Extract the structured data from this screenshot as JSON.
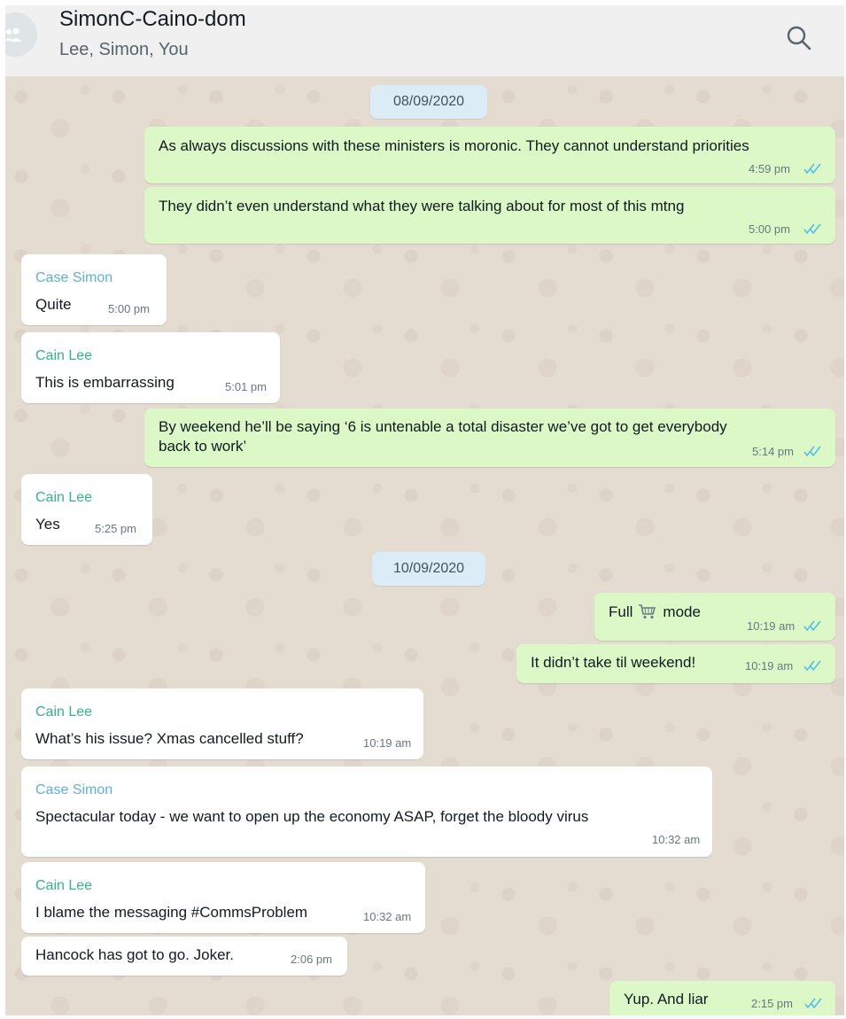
{
  "header": {
    "title": "SimonC-Caino-dom",
    "members": "Lee, Simon, You",
    "icons": [
      "group-avatar-icon",
      "search-icon"
    ]
  },
  "colors": {
    "outgoing_bubble": "#dcf8c6",
    "incoming_bubble": "#ffffff",
    "date_chip": "#dbecf6",
    "read_ticks": "#53bdeb",
    "sender_cain": "#35b289",
    "sender_case": "#5fb0d6"
  },
  "dates": {
    "d1": "08/09/2020",
    "d2": "10/09/2020"
  },
  "messages": [
    {
      "direction": "out",
      "text": "As always discussions with these ministers is moronic. They cannot understand priorities",
      "time": "4:59 pm",
      "status": "read"
    },
    {
      "direction": "out",
      "text": "They didn’t even understand what they were talking about for most of this mtng",
      "time": "5:00 pm",
      "status": "read"
    },
    {
      "direction": "in",
      "sender": "Case Simon",
      "text": "Quite",
      "time": "5:00 pm"
    },
    {
      "direction": "in",
      "sender": "Cain Lee",
      "text": "This is embarrassing",
      "time": "5:01 pm"
    },
    {
      "direction": "out",
      "text_line1": "By weekend he’ll be saying ‘6 is untenable a total disaster we’ve got to get everybody",
      "text_line2": "back to work’",
      "time": "5:14 pm",
      "status": "read"
    },
    {
      "direction": "in",
      "sender": "Cain Lee",
      "text": "Yes",
      "time": "5:25 pm"
    },
    {
      "direction": "out",
      "text_before": "Full",
      "emoji": "shopping-cart-icon",
      "text_after": "mode",
      "time": "10:19 am",
      "status": "read"
    },
    {
      "direction": "out",
      "text": "It didn’t take til weekend!",
      "time": "10:19 am",
      "status": "read"
    },
    {
      "direction": "in",
      "sender": "Cain Lee",
      "text": "What’s his issue? Xmas cancelled stuff?",
      "time": "10:19 am"
    },
    {
      "direction": "in",
      "sender": "Case Simon",
      "text": "Spectacular today - we want to open up the economy ASAP, forget the bloody virus",
      "time": "10:32 am"
    },
    {
      "direction": "in",
      "sender": "Cain Lee",
      "text": "I blame the messaging #CommsProblem",
      "time": "10:32 am"
    },
    {
      "direction": "in",
      "text": "Hancock has got to go. Joker.",
      "time": "2:06 pm"
    },
    {
      "direction": "out",
      "text": "Yup. And liar",
      "time": "2:15 pm",
      "status": "read"
    }
  ]
}
